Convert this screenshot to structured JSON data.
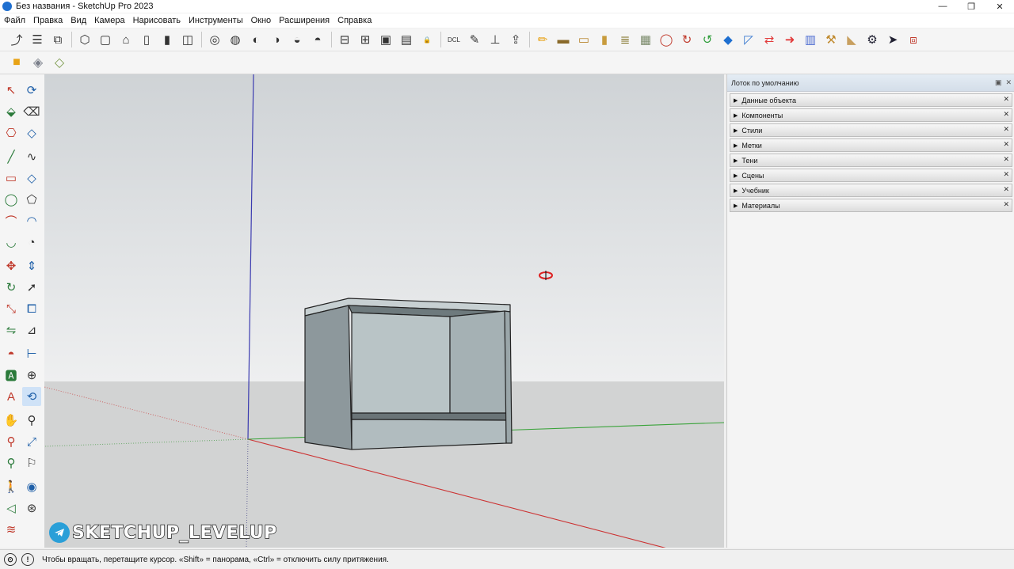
{
  "window": {
    "title": "Без названия - SketchUp Pro 2023",
    "minimize_glyph": "—",
    "maximize_glyph": "❐",
    "close_glyph": "✕"
  },
  "menu": [
    "Файл",
    "Правка",
    "Вид",
    "Камера",
    "Нарисовать",
    "Инструменты",
    "Окно",
    "Расширения",
    "Справка"
  ],
  "tray": {
    "title": "Лоток по умолчанию",
    "pin_glyph": "▣",
    "close_glyph": "✕",
    "panels": [
      {
        "label": "Данные объекта",
        "expanded": false
      },
      {
        "label": "Компоненты",
        "expanded": false
      },
      {
        "label": "Стили",
        "expanded": false
      },
      {
        "label": "Метки",
        "expanded": false
      },
      {
        "label": "Тени",
        "expanded": false
      },
      {
        "label": "Сцены",
        "expanded": false
      },
      {
        "label": "Учебник",
        "expanded": false
      },
      {
        "label": "Материалы",
        "expanded": false
      }
    ]
  },
  "statusbar": {
    "text": "Чтобы вращать, перетащите курсор. «Shift» = панорама, «Ctrl» = отключить силу притяжения."
  },
  "watermark": {
    "text": "SKETCHUP_LEVELUP"
  },
  "toolbar_top": [
    {
      "name": "styles-select-icon",
      "glyph": "⤴"
    },
    {
      "name": "list-icon",
      "glyph": "☰"
    },
    {
      "name": "component-icon",
      "glyph": "⧉"
    },
    {
      "name": "iso-view-icon",
      "glyph": "⬡"
    },
    {
      "name": "top-view-icon",
      "glyph": "▢"
    },
    {
      "name": "front-view-icon",
      "glyph": "⌂"
    },
    {
      "name": "right-view-icon",
      "glyph": "▯"
    },
    {
      "name": "back-view-icon",
      "glyph": "▮"
    },
    {
      "name": "left-view-icon",
      "glyph": "◫"
    },
    {
      "name": "xray-icon",
      "glyph": "◎"
    },
    {
      "name": "wireframe-icon",
      "glyph": "◍"
    },
    {
      "name": "hidden-line-icon",
      "glyph": "◐"
    },
    {
      "name": "shaded-icon",
      "glyph": "◑"
    },
    {
      "name": "textured-icon",
      "glyph": "◒"
    },
    {
      "name": "monochrome-icon",
      "glyph": "◓"
    },
    {
      "name": "section-plane-icon",
      "glyph": "⊟"
    },
    {
      "name": "section-cut-icon",
      "glyph": "⊞"
    },
    {
      "name": "section-fill-icon",
      "glyph": "▣"
    },
    {
      "name": "section-display-icon",
      "glyph": "▤"
    },
    {
      "name": "section-lock-icon",
      "glyph": "🔒"
    },
    {
      "name": "dcl-icon",
      "glyph": "DCL"
    },
    {
      "name": "interact-icon",
      "glyph": "✎"
    },
    {
      "name": "axes-icon",
      "glyph": "⊥"
    },
    {
      "name": "export-icon",
      "glyph": "⇪"
    },
    {
      "name": "pencil-icon",
      "glyph": "✏"
    },
    {
      "name": "board-icon",
      "glyph": "▬"
    },
    {
      "name": "plank-icon",
      "glyph": "▭"
    },
    {
      "name": "post-icon",
      "glyph": "▮"
    },
    {
      "name": "stack-icon",
      "glyph": "≣"
    },
    {
      "name": "box-icon",
      "glyph": "▦"
    },
    {
      "name": "ring-icon",
      "glyph": "◯"
    },
    {
      "name": "rotate-red-icon",
      "glyph": "↻"
    },
    {
      "name": "rotate-green-icon",
      "glyph": "↺"
    },
    {
      "name": "shape-icon",
      "glyph": "◆"
    },
    {
      "name": "measure-icon",
      "glyph": "◸"
    },
    {
      "name": "move-icon",
      "glyph": "⇄"
    },
    {
      "name": "arrow-red-icon",
      "glyph": "➜"
    },
    {
      "name": "ruler-icon",
      "glyph": "▥"
    },
    {
      "name": "drill-icon",
      "glyph": "⚒"
    },
    {
      "name": "wood-icon",
      "glyph": "◣"
    },
    {
      "name": "settings-icon",
      "glyph": "⚙"
    },
    {
      "name": "cursor-icon",
      "glyph": "➤"
    },
    {
      "name": "extension-icon",
      "glyph": "⧈"
    }
  ],
  "toolbar_second": [
    {
      "name": "solid-tools-icon",
      "glyph": "■"
    },
    {
      "name": "solid-outer-icon",
      "glyph": "◈"
    },
    {
      "name": "solid-trim-icon",
      "glyph": "◇"
    }
  ],
  "left_tools": [
    {
      "name": "select-icon",
      "glyph": "↖",
      "active": false
    },
    {
      "name": "lasso-icon",
      "glyph": "⟳",
      "active": false
    },
    {
      "name": "paint-bucket-icon",
      "glyph": "⬙",
      "active": false
    },
    {
      "name": "eraser-icon",
      "glyph": "⌫",
      "active": false
    },
    {
      "name": "make-component-icon",
      "glyph": "⎔",
      "active": false
    },
    {
      "name": "tag-tool-icon",
      "glyph": "◇",
      "active": false
    },
    {
      "name": "line-icon",
      "glyph": "╱",
      "active": false
    },
    {
      "name": "freehand-icon",
      "glyph": "∿",
      "active": false
    },
    {
      "name": "rectangle-icon",
      "glyph": "▭",
      "active": false
    },
    {
      "name": "rotated-rect-icon",
      "glyph": "◇",
      "active": false
    },
    {
      "name": "circle-icon",
      "glyph": "◯",
      "active": false
    },
    {
      "name": "polygon-icon",
      "glyph": "⬠",
      "active": false
    },
    {
      "name": "arc-icon",
      "glyph": "⌒",
      "active": false
    },
    {
      "name": "two-point-arc-icon",
      "glyph": "◠",
      "active": false
    },
    {
      "name": "three-point-arc-icon",
      "glyph": "◡",
      "active": false
    },
    {
      "name": "pie-icon",
      "glyph": "◔",
      "active": false
    },
    {
      "name": "move-tool-icon",
      "glyph": "✥",
      "active": false
    },
    {
      "name": "push-pull-icon",
      "glyph": "⇕",
      "active": false
    },
    {
      "name": "rotate-tool-icon",
      "glyph": "↻",
      "active": false
    },
    {
      "name": "follow-me-icon",
      "glyph": "➚",
      "active": false
    },
    {
      "name": "scale-icon",
      "glyph": "⤡",
      "active": false
    },
    {
      "name": "offset-icon",
      "glyph": "⧠",
      "active": false
    },
    {
      "name": "flip-icon",
      "glyph": "⇋",
      "active": false
    },
    {
      "name": "tape-measure-icon",
      "glyph": "⊿",
      "active": false
    },
    {
      "name": "protractor-icon",
      "glyph": "◓",
      "active": false
    },
    {
      "name": "dimension-icon",
      "glyph": "⊢",
      "active": false
    },
    {
      "name": "text-tool-icon",
      "glyph": "🅰",
      "active": false
    },
    {
      "name": "axes-tool-icon",
      "glyph": "⊕",
      "active": false
    },
    {
      "name": "3d-text-icon",
      "glyph": "A",
      "active": false
    },
    {
      "name": "orbit-icon",
      "glyph": "⟲",
      "active": true
    },
    {
      "name": "pan-icon",
      "glyph": "✋",
      "active": false
    },
    {
      "name": "zoom-icon",
      "glyph": "⚲",
      "active": false
    },
    {
      "name": "zoom-window-icon",
      "glyph": "⚲",
      "active": false
    },
    {
      "name": "zoom-extents-icon",
      "glyph": "⤢",
      "active": false
    },
    {
      "name": "previous-view-icon",
      "glyph": "⚲",
      "active": false
    },
    {
      "name": "position-camera-icon",
      "glyph": "⚐",
      "active": false
    },
    {
      "name": "walk-icon",
      "glyph": "🚶",
      "active": false
    },
    {
      "name": "look-around-icon",
      "glyph": "◉",
      "active": false
    },
    {
      "name": "section-tool-icon",
      "glyph": "◁",
      "active": false
    },
    {
      "name": "sandbox-icon",
      "glyph": "⊛",
      "active": false
    },
    {
      "name": "smoove-icon",
      "glyph": "≋",
      "active": false
    }
  ],
  "colors": {
    "sky_top": "#cfd3d6",
    "sky_bottom": "#edeeef",
    "ground": "#d2d3d3",
    "box_face": "#a9b5b8",
    "box_dark": "#7d888c",
    "axis_red": "#cc3333",
    "axis_green": "#3aa33a",
    "axis_blue": "#3b3bb0",
    "accent": "#1e6fd0"
  }
}
